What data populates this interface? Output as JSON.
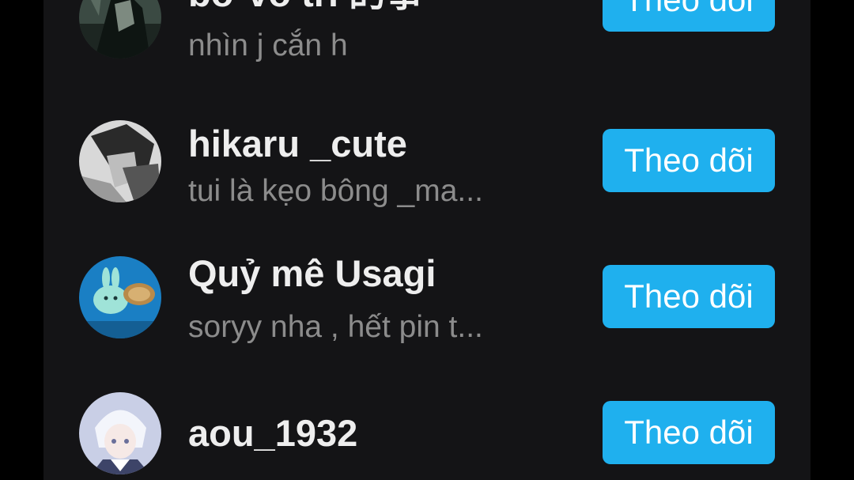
{
  "users": [
    {
      "username": "bơ vô tri 的事",
      "bio": "nhìn j cắn h",
      "button_label": "Theo dõi"
    },
    {
      "username": "hikaru _cute",
      "bio": "tui là kẹo bông _ma...",
      "button_label": "Theo dõi"
    },
    {
      "username": "Quỷ mê Usagi",
      "bio": "soryy nha , hết pin t...",
      "button_label": "Theo dõi"
    },
    {
      "username": "aou_1932",
      "bio": "",
      "button_label": "Theo dõi"
    }
  ],
  "colors": {
    "background": "#000000",
    "panel": "#141416",
    "username": "#eeeeee",
    "bio": "#8c8c8c",
    "button": "#1fb0ee",
    "button_text": "#ffffff"
  }
}
